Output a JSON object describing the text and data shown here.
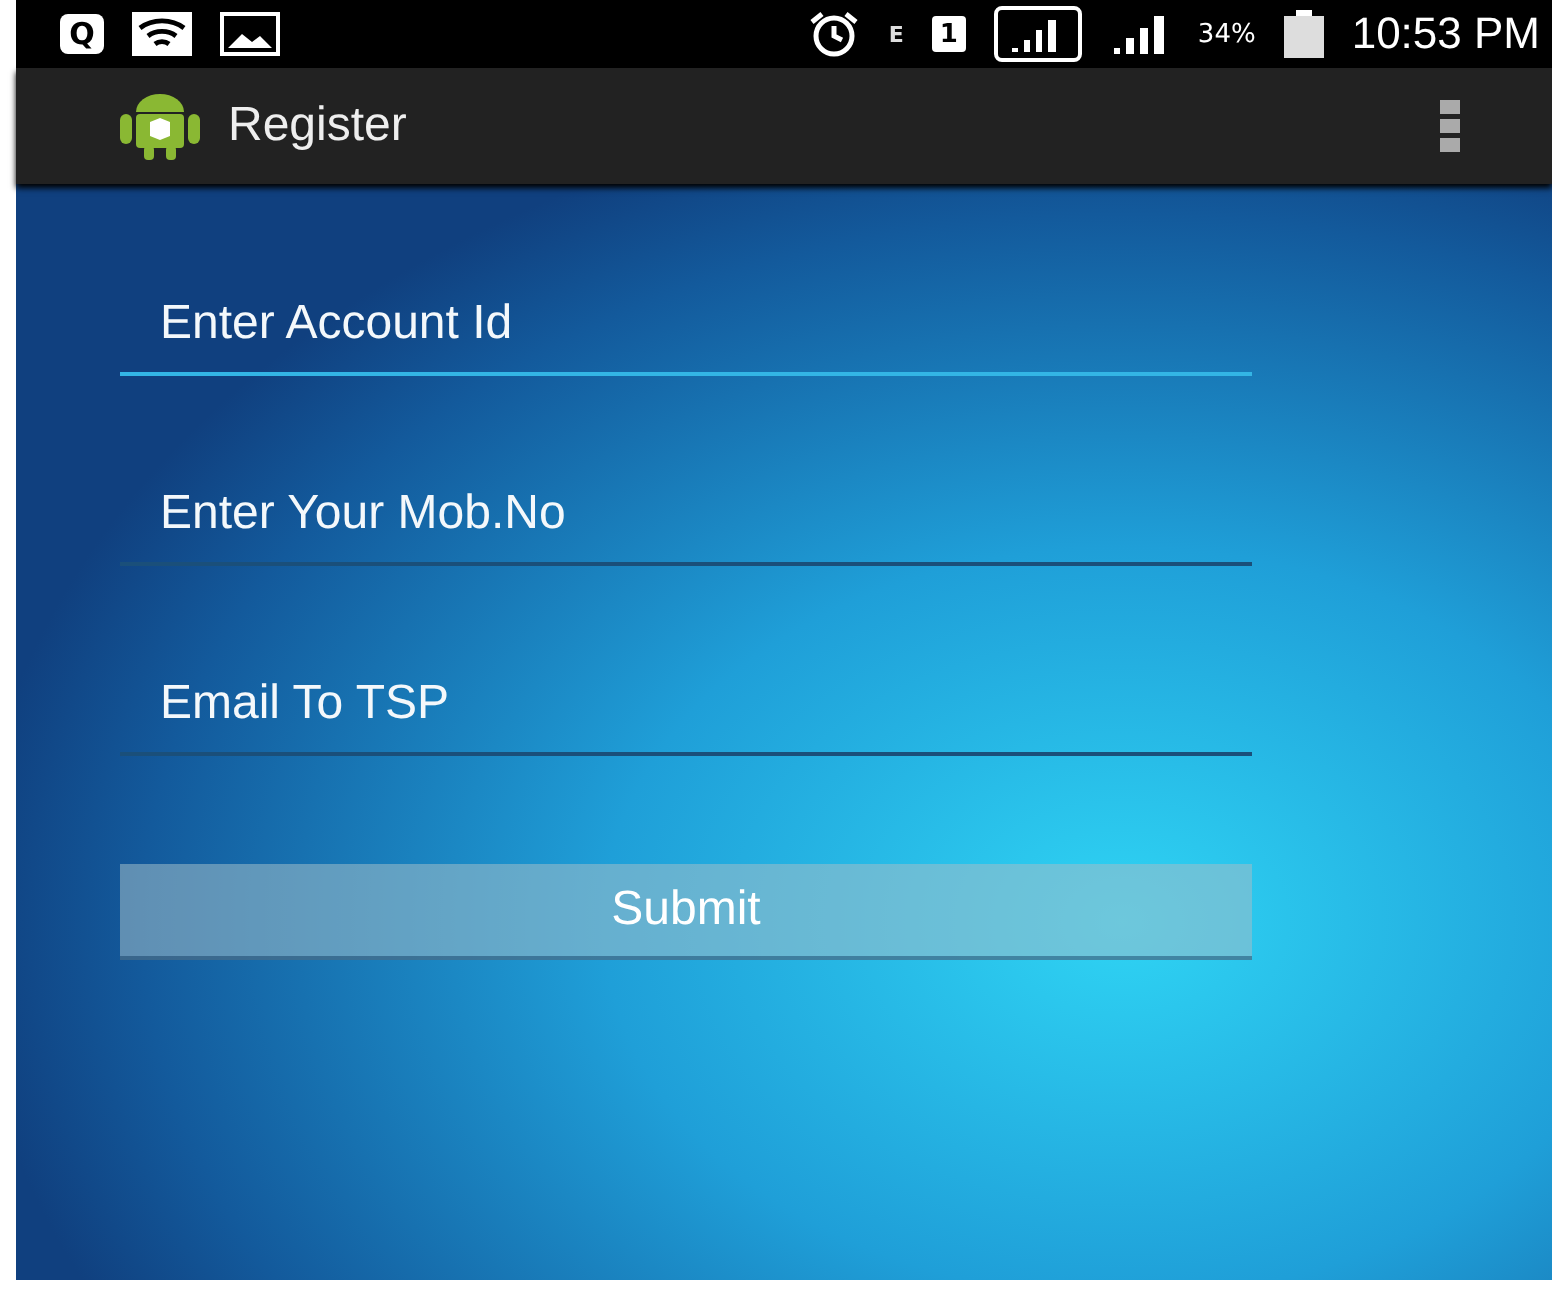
{
  "status_bar": {
    "notification_letter": "Q",
    "network_type": "E",
    "sim_slot": "1",
    "battery": "34%",
    "time": "10:53 PM"
  },
  "action_bar": {
    "title": "Register"
  },
  "fields": [
    {
      "placeholder": "Enter Account Id",
      "focused": true
    },
    {
      "placeholder": "Enter Your Mob.No",
      "focused": false
    },
    {
      "placeholder": "Email To TSP",
      "focused": false
    }
  ],
  "buttons": [
    "Submit"
  ]
}
